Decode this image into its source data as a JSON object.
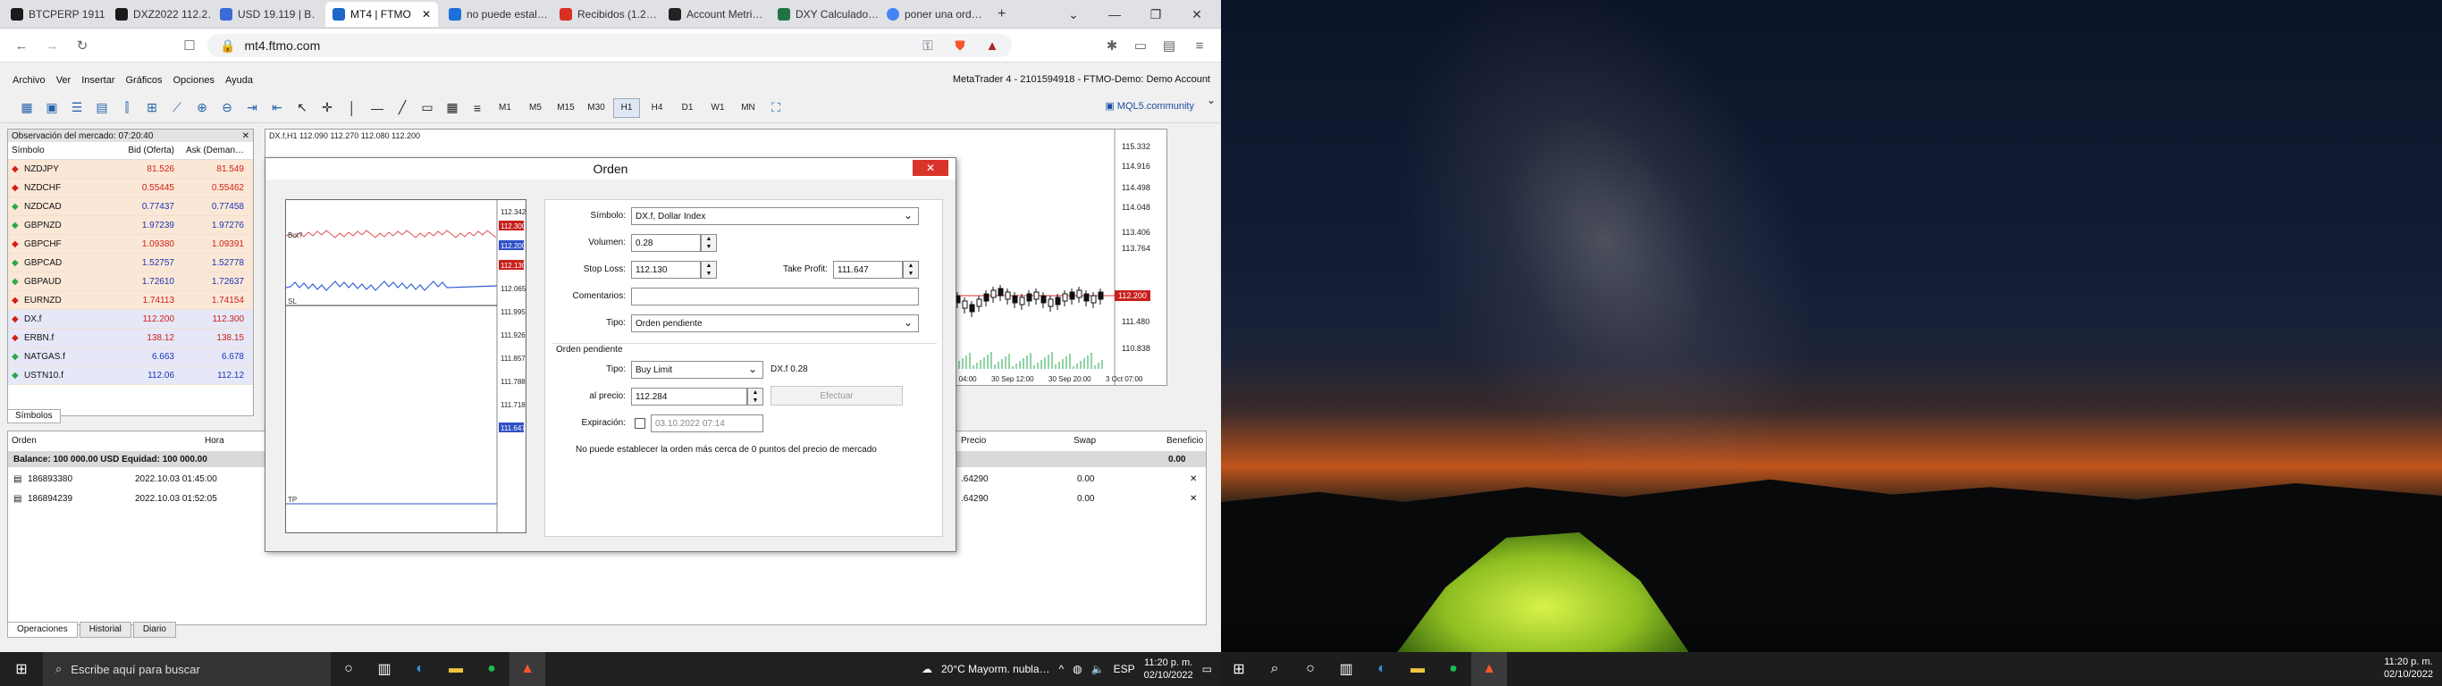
{
  "browser": {
    "tabs": [
      {
        "label": "BTCPERP 1911…",
        "color": "#1a1a1a"
      },
      {
        "label": "DXZ2022 112.2…",
        "color": "#1a1a1a"
      },
      {
        "label": "USD 19.119 | B…",
        "color": "#3a6bd8"
      },
      {
        "label": "MT4 | FTMO",
        "color": "#1f66c8"
      },
      {
        "label": "no puede estal…",
        "color": "#1d6fd9"
      },
      {
        "label": "Recibidos (1.2…",
        "color": "#d93025"
      },
      {
        "label": "Account Metri…",
        "color": "#222222"
      },
      {
        "label": "DXY Calculado…",
        "color": "#217346"
      },
      {
        "label": "poner una ord…",
        "color": "#4285f4"
      }
    ],
    "new_tab": "+",
    "url": "mt4.ftmo.com"
  },
  "mt4": {
    "menu": [
      "Archivo",
      "Ver",
      "Insertar",
      "Gráficos",
      "Opciones",
      "Ayuda"
    ],
    "title": "MetaTrader 4 - 2101594918 - FTMO-Demo: Demo Account",
    "timeframes": [
      "M1",
      "M5",
      "M15",
      "M30",
      "H1",
      "H4",
      "D1",
      "W1",
      "MN"
    ],
    "mql": "MQL5.community",
    "market_watch": {
      "header": "Observación del mercado: 07:20:40",
      "cols": [
        "Símbolo",
        "Bid (Oferta)",
        "Ask (Deman…"
      ],
      "rows": [
        {
          "sym": "NZDJPY",
          "bid": "81.526",
          "ask": "81.549",
          "dir": "down"
        },
        {
          "sym": "NZDCHF",
          "bid": "0.55445",
          "ask": "0.55462",
          "dir": "down"
        },
        {
          "sym": "NZDCAD",
          "bid": "0.77437",
          "ask": "0.77458",
          "dir": "up"
        },
        {
          "sym": "GBPNZD",
          "bid": "1.97239",
          "ask": "1.97276",
          "dir": "up"
        },
        {
          "sym": "GBPCHF",
          "bid": "1.09380",
          "ask": "1.09391",
          "dir": "down"
        },
        {
          "sym": "GBPCAD",
          "bid": "1.52757",
          "ask": "1.52778",
          "dir": "up"
        },
        {
          "sym": "GBPAUD",
          "bid": "1.72610",
          "ask": "1.72637",
          "dir": "up"
        },
        {
          "sym": "EURNZD",
          "bid": "1.74113",
          "ask": "1.74154",
          "dir": "down"
        },
        {
          "sym": "DX.f",
          "bid": "112.200",
          "ask": "112.300",
          "dir": "down"
        },
        {
          "sym": "ERBN.f",
          "bid": "138.12",
          "ask": "138.15",
          "dir": "down"
        },
        {
          "sym": "NATGAS.f",
          "bid": "6.663",
          "ask": "6.678",
          "dir": "up"
        },
        {
          "sym": "USTN10.f",
          "bid": "112.06",
          "ask": "112.12",
          "dir": "up"
        }
      ],
      "tab": "Símbolos"
    },
    "chart": {
      "info": "DX.f,H1  112.090 112.270 112.080 112.200",
      "price_ticks": [
        "115.332",
        "114.916",
        "114.498",
        "114.048",
        "113.406",
        "113.764",
        "112.200",
        "111.480",
        "110.838"
      ],
      "last_price": "112.200",
      "time_ticks": [
        "30 Sep 04:00",
        "30 Sep 12:00",
        "30 Sep 20:00",
        "3 Oct 07:00"
      ]
    },
    "terminal": {
      "cols": [
        "Orden",
        "Hora",
        "Precio",
        "Swap",
        "Beneficio"
      ],
      "balance": "Balance: 100 000.00 USD  Equidad: 100 000.00",
      "balance_profit": "0.00",
      "rows": [
        {
          "order": "186893380",
          "time": "2022.10.03 01:45:00",
          "price": ".64290",
          "swap": "0.00"
        },
        {
          "order": "186894239",
          "time": "2022.10.03 01:52:05",
          "price": ".64290",
          "swap": "0.00"
        }
      ],
      "tabs": [
        "Operaciones",
        "Historial",
        "Diario"
      ]
    }
  },
  "dialog": {
    "title": "Orden",
    "close": "✕",
    "mini_prices": [
      "112.342",
      "112.300",
      "112.200",
      "112.130",
      "112.065",
      "111.995",
      "111.926",
      "111.857",
      "111.788",
      "111.718",
      "111.647"
    ],
    "mini_labels": {
      "bid": "Bot?",
      "sl": "SL",
      "tp": "TP"
    },
    "symbol_label": "Símbolo:",
    "symbol": "DX.f, Dollar Index",
    "volume_label": "Volumen:",
    "volume": "0.28",
    "sl_label": "Stop Loss:",
    "sl": "112.130",
    "tp_label": "Take Profit:",
    "tp": "111.647",
    "comment_label": "Comentarios:",
    "comment": "",
    "type_label": "Tipo:",
    "type": "Orden pendiente",
    "pending_header": "Orden pendiente",
    "ptype_label": "Tipo:",
    "ptype": "Buy Limit",
    "ptype_info": "DX.f 0.28",
    "price_label": "al precio:",
    "price": "112.284",
    "submit": "Efectuar",
    "expiry_label": "Expiración:",
    "expiry": "03.10.2022 07:14",
    "warning": "No puede establecer la orden más cerca de 0 puntos del precio de mercado"
  },
  "taskbar": {
    "search": "Escribe aquí para buscar",
    "weather": "20°C  Mayorm. nubla…",
    "time": "11:20 p. m.",
    "date": "02/10/2022",
    "time2": "11:20 p. m.",
    "date2": "02/10/2022"
  }
}
